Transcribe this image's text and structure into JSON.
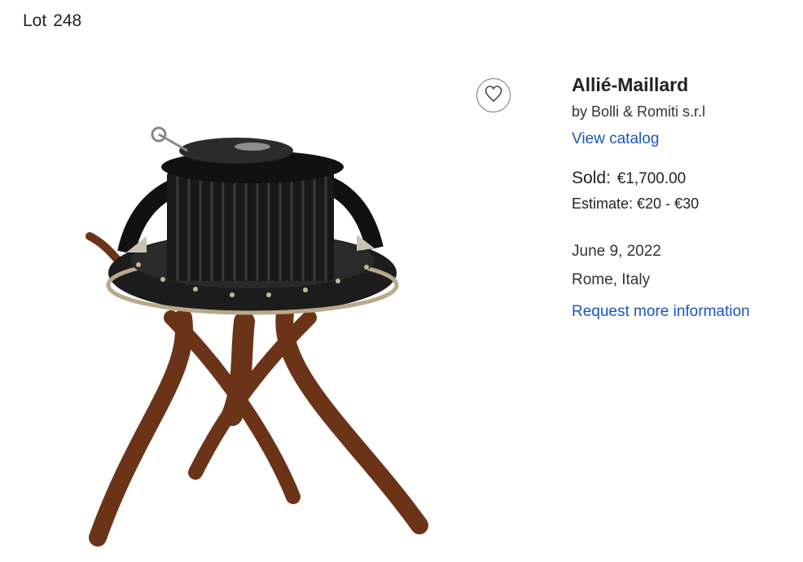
{
  "lot": {
    "label": "Lot",
    "number": "248"
  },
  "item": {
    "title": "Allié-Maillard",
    "auction_house": "by Bolli & Romiti s.r.l",
    "view_catalog": "View catalog",
    "sold_label": "Sold:",
    "sold_value": "€1,700.00",
    "estimate": "Estimate: €20 - €30",
    "date": "June 9, 2022",
    "location": "Rome, Italy",
    "request_info": "Request more information"
  },
  "icons": {
    "favorite": "heart-icon"
  },
  "colors": {
    "link": "#1a56c4",
    "text": "#222222"
  }
}
